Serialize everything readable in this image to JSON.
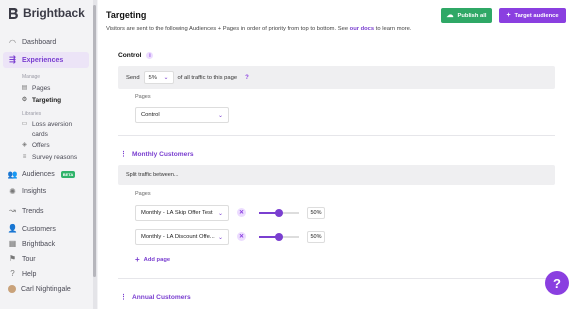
{
  "brand": {
    "name": "Brightback"
  },
  "sidebar": {
    "items": [
      {
        "label": "Dashboard",
        "icon": "gauge-icon"
      },
      {
        "label": "Experiences",
        "icon": "flow-icon"
      }
    ],
    "manage_header": "Manage",
    "manage_items": [
      {
        "label": "Pages",
        "icon": "page-icon"
      },
      {
        "label": "Targeting",
        "icon": "target-icon"
      }
    ],
    "libraries_header": "Libraries",
    "library_items": [
      {
        "label": "Loss aversion",
        "label2": "cards",
        "icon": "cards-icon"
      },
      {
        "label": "Offers",
        "icon": "tag-icon"
      },
      {
        "label": "Survey reasons",
        "icon": "list-icon"
      }
    ],
    "lower_items": [
      {
        "label": "Audiences",
        "icon": "users-icon",
        "badge": "BETA"
      },
      {
        "label": "Insights",
        "icon": "bulb-icon"
      },
      {
        "label": "Trends",
        "icon": "trend-icon"
      },
      {
        "label": "Customers",
        "icon": "people-icon"
      },
      {
        "label": "Brightback",
        "icon": "building-icon"
      },
      {
        "label": "Tour",
        "icon": "flag-icon"
      },
      {
        "label": "Help",
        "icon": "help-icon"
      },
      {
        "label": "Carl Nightingale",
        "icon": "avatar-icon"
      }
    ]
  },
  "header": {
    "title": "Targeting",
    "subtitle": "Visitors are sent to the following Audiences + Pages in order of priority from top to bottom. See ",
    "docs_link": "our docs",
    "subtitle_end": " to learn more.",
    "publish_label": "Publish all",
    "target_label": "Target audience"
  },
  "control": {
    "title": "Control",
    "send_label": "Send",
    "send_value": "5%",
    "send_suffix": "of all traffic to this page",
    "pages_label": "Pages",
    "page_value": "Control"
  },
  "monthly": {
    "title": "Monthly Customers",
    "split_label": "Split traffic between...",
    "pages_label": "Pages",
    "rows": [
      {
        "page": "Monthly - LA Skip Offer Test",
        "percent": "50%",
        "fraction": 0.5
      },
      {
        "page": "Monthly - LA Discount Offe...",
        "percent": "50%",
        "fraction": 0.5
      }
    ],
    "add_page_label": "Add page"
  },
  "annual": {
    "title": "Annual Customers"
  },
  "colors": {
    "accent": "#7a3fd0",
    "publish": "#2fa866",
    "target": "#8a3fe0"
  }
}
